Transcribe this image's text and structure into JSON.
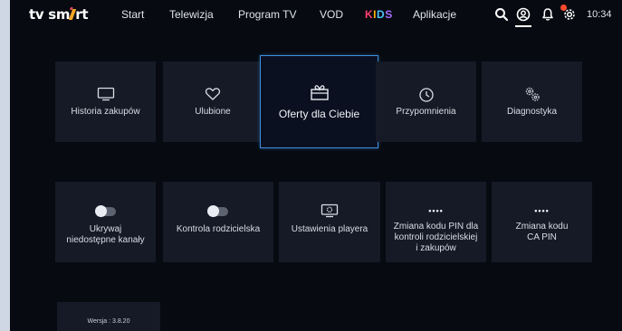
{
  "brand": {
    "logo_part1": "tv sm",
    "logo_part2": "rt"
  },
  "nav": {
    "items": [
      "Start",
      "Telewizja",
      "Program TV",
      "VOD"
    ],
    "kids": [
      "K",
      "I",
      "D",
      "S"
    ],
    "apps": "Aplikacje"
  },
  "topbar": {
    "time": "10:34"
  },
  "tiles_row1": [
    {
      "label": "Historia zakupów",
      "icon": "tv-icon"
    },
    {
      "label": "Ulubione",
      "icon": "heart-icon"
    },
    {
      "label": "Oferty dla Ciebie",
      "icon": "gift-icon",
      "focused": true
    },
    {
      "label": "Przypomnienia",
      "icon": "clock-icon"
    },
    {
      "label": "Diagnostyka",
      "icon": "gears-icon"
    }
  ],
  "tiles_row2": [
    {
      "label_lines": [
        "Ukrywaj",
        "niedostępne kanały"
      ],
      "icon": "toggle-icon"
    },
    {
      "label_lines": [
        "Kontrola rodzicielska"
      ],
      "icon": "toggle-icon"
    },
    {
      "label_lines": [
        "Ustawienia playera"
      ],
      "icon": "player-settings-icon"
    },
    {
      "dots": "••••",
      "label_lines": [
        "Zmiana kodu PIN dla",
        "kontroli rodzicielskiej",
        "i zakupów"
      ],
      "icon": "pin-dots-icon"
    },
    {
      "dots": "••••",
      "label_lines": [
        "Zmiana kodu",
        "CA PIN"
      ],
      "icon": "pin-dots-icon"
    }
  ],
  "version": {
    "label": "Wersja : 3.8.20"
  },
  "colors": {
    "background": "#070a11",
    "tile": "#151a26",
    "focus_border": "#3f8fe0",
    "notification": "#ff4a2e"
  }
}
